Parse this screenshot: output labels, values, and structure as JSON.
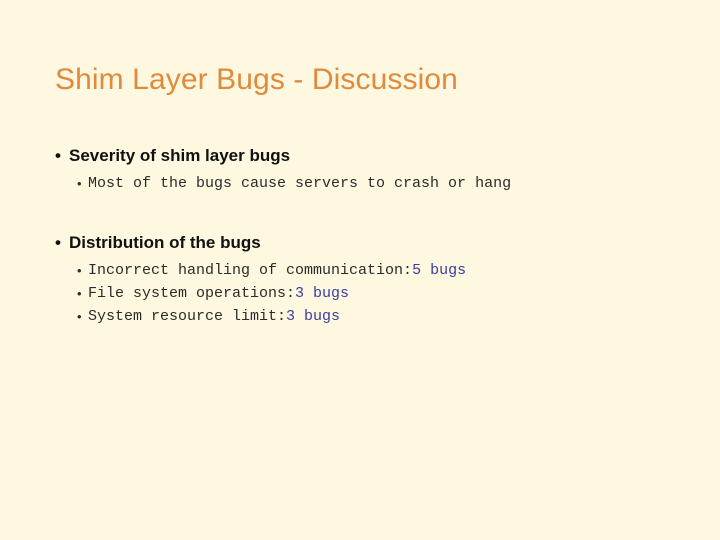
{
  "slide": {
    "title": "Shim Layer Bugs - Discussion",
    "background_color": "#fdf8df",
    "title_color": "#e08a3c",
    "body_text_color": "#111111",
    "mono_text_color": "#2b2b2b",
    "count_color": "#3a3f9e",
    "bullet_glyph": "•",
    "sections": [
      {
        "heading": "Severity of shim layer bugs",
        "items": [
          {
            "text": "Most of the bugs cause servers to crash or hang",
            "count": ""
          }
        ]
      },
      {
        "heading": "Distribution of the bugs",
        "items": [
          {
            "text": "Incorrect handling of communication: ",
            "count": "5 bugs"
          },
          {
            "text": "File system operations: ",
            "count": "3 bugs"
          },
          {
            "text": "System resource limit: ",
            "count": "3 bugs"
          }
        ]
      }
    ]
  }
}
